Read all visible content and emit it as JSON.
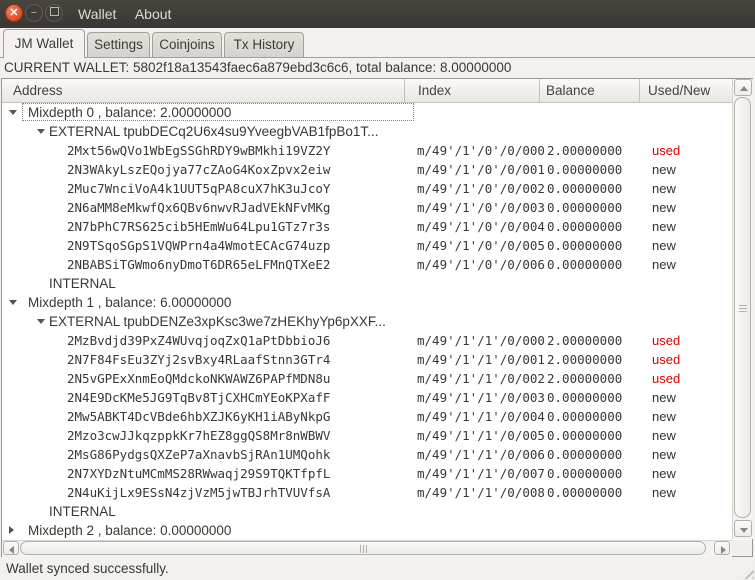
{
  "titlebar": {
    "close_glyph": "✕",
    "minimize_glyph": "−",
    "menu_items": [
      {
        "label": "Wallet"
      },
      {
        "label": "About"
      }
    ]
  },
  "tabs": [
    {
      "label": "JM Wallet",
      "active": true
    },
    {
      "label": "Settings",
      "active": false
    },
    {
      "label": "Coinjoins",
      "active": false
    },
    {
      "label": "Tx History",
      "active": false
    }
  ],
  "current_wallet": "CURRENT WALLET: 5802f18a13543faec6a879ebd3c6c6, total balance: 8.00000000",
  "table": {
    "columns": [
      "Address",
      "Index",
      "Balance",
      "Used/New"
    ]
  },
  "rows": [
    {
      "type": "mixdepth",
      "level": 1,
      "expanded": true,
      "focused": true,
      "label": "Mixdepth 0 , balance: 2.00000000"
    },
    {
      "type": "branch",
      "level": 2,
      "expanded": true,
      "label": "EXTERNAL tpubDECq2U6x4su9YveegbVAB1fpBo1T..."
    },
    {
      "type": "address",
      "address": "2Mxt56wQVo1WbEgSSGhRDY9wBMkhi19VZ2Y",
      "index": "m/49'/1'/0'/0/000",
      "balance": "2.00000000",
      "status": "used"
    },
    {
      "type": "address",
      "address": "2N3WAkyLszEQojya77cZAoG4KoxZpvx2eiw",
      "index": "m/49'/1'/0'/0/001",
      "balance": "0.00000000",
      "status": "new"
    },
    {
      "type": "address",
      "address": "2Muc7WnciVoA4k1UUT5qPA8cuX7hK3uJcoY",
      "index": "m/49'/1'/0'/0/002",
      "balance": "0.00000000",
      "status": "new"
    },
    {
      "type": "address",
      "address": "2N6aMM8eMkwfQx6QBv6nwvRJadVEkNFvMKg",
      "index": "m/49'/1'/0'/0/003",
      "balance": "0.00000000",
      "status": "new"
    },
    {
      "type": "address",
      "address": "2N7bPhC7RS625cib5HEmWu64Lpu1GTz7r3s",
      "index": "m/49'/1'/0'/0/004",
      "balance": "0.00000000",
      "status": "new"
    },
    {
      "type": "address",
      "address": "2N9TSqoSGpS1VQWPrn4a4WmotECAcG74uzp",
      "index": "m/49'/1'/0'/0/005",
      "balance": "0.00000000",
      "status": "new"
    },
    {
      "type": "address",
      "address": "2NBABSiTGWmo6nyDmoT6DR65eLFMnQTXeE2",
      "index": "m/49'/1'/0'/0/006",
      "balance": "0.00000000",
      "status": "new"
    },
    {
      "type": "branch",
      "level": 2,
      "label": "INTERNAL"
    },
    {
      "type": "mixdepth",
      "level": 1,
      "expanded": true,
      "label": "Mixdepth 1 , balance: 6.00000000"
    },
    {
      "type": "branch",
      "level": 2,
      "expanded": true,
      "label": "EXTERNAL tpubDENZe3xpKsc3we7zHEKhyYp6pXXF..."
    },
    {
      "type": "address",
      "address": "2MzBvdjd39PxZ4WUvqjoqZxQ1aPtDbbioJ6",
      "index": "m/49'/1'/1'/0/000",
      "balance": "2.00000000",
      "status": "used"
    },
    {
      "type": "address",
      "address": "2N7F84FsEu3ZYj2svBxy4RLaafStnn3GTr4",
      "index": "m/49'/1'/1'/0/001",
      "balance": "2.00000000",
      "status": "used"
    },
    {
      "type": "address",
      "address": "2N5vGPExXnmEoQMdckoNKWAWZ6PAPfMDN8u",
      "index": "m/49'/1'/1'/0/002",
      "balance": "2.00000000",
      "status": "used"
    },
    {
      "type": "address",
      "address": "2N4E9DcKMe5JG9TqBv8TjCXHCmYEoKPXafF",
      "index": "m/49'/1'/1'/0/003",
      "balance": "0.00000000",
      "status": "new"
    },
    {
      "type": "address",
      "address": "2Mw5ABKT4DcVBde6hbXZJK6yKH1iAByNkpG",
      "index": "m/49'/1'/1'/0/004",
      "balance": "0.00000000",
      "status": "new"
    },
    {
      "type": "address",
      "address": "2Mzo3cwJJkqzppkKr7hEZ8ggQS8Mr8nWBWV",
      "index": "m/49'/1'/1'/0/005",
      "balance": "0.00000000",
      "status": "new"
    },
    {
      "type": "address",
      "address": "2MsG86PydgsQXZeP7aXnavbSjRAn1UMQohk",
      "index": "m/49'/1'/1'/0/006",
      "balance": "0.00000000",
      "status": "new"
    },
    {
      "type": "address",
      "address": "2N7XYDzNtuMCmMS28RWwaqj29S9TQKTfpfL",
      "index": "m/49'/1'/1'/0/007",
      "balance": "0.00000000",
      "status": "new"
    },
    {
      "type": "address",
      "address": "2N4uKijLx9ESsN4zjVzM5jwTBJrhTVUVfsA",
      "index": "m/49'/1'/1'/0/008",
      "balance": "0.00000000",
      "status": "new"
    },
    {
      "type": "branch",
      "level": 2,
      "label": "INTERNAL"
    },
    {
      "type": "mixdepth",
      "level": 1,
      "expanded": false,
      "label": "Mixdepth 2 , balance: 0.00000000"
    }
  ],
  "statusbar": {
    "text": "Wallet synced successfully."
  },
  "colors": {
    "titlebar_bg": "#3c3936",
    "close_button": "#dc4b23",
    "window_bg": "#f2f1ef",
    "tree_bg": "#ffffff",
    "used_status": "#e20000",
    "new_status": "#34322e",
    "text": "#393833"
  }
}
